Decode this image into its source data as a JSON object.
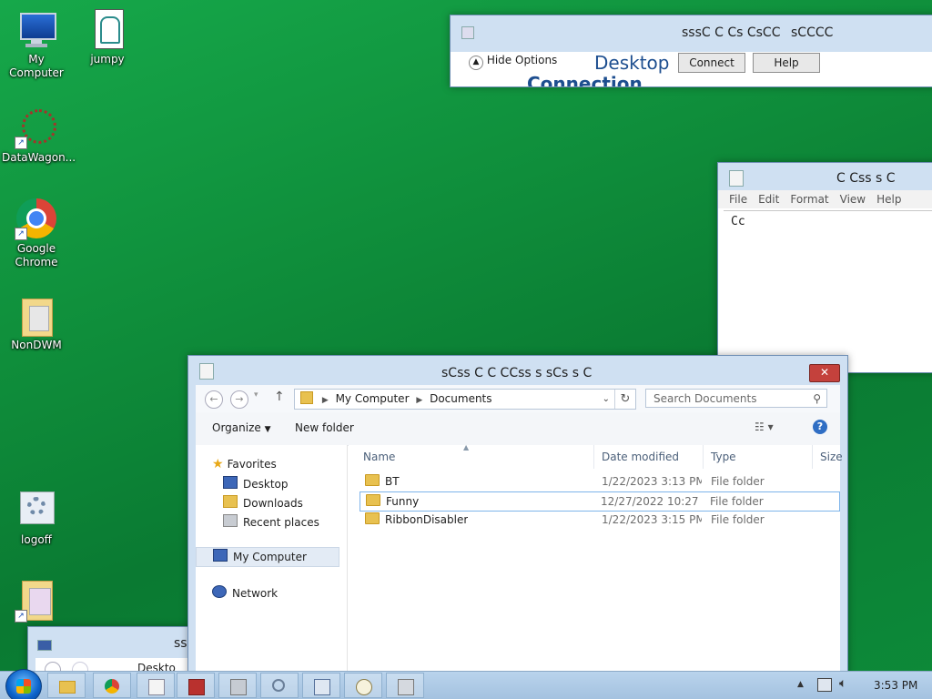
{
  "desktop": {
    "icons": [
      {
        "label": "My Computer"
      },
      {
        "label": "jumpy"
      },
      {
        "label": "DataWagon..."
      },
      {
        "label": "Google Chrome"
      },
      {
        "label": "NonDWM"
      },
      {
        "label": "logoff"
      }
    ]
  },
  "rdp": {
    "title": "sssC C Cs CsCC",
    "title_right": "sCCCC",
    "hide_options": "Hide Options",
    "brand": "Desktop",
    "brand2": "Connection",
    "connect": "Connect",
    "help": "Help"
  },
  "notepad": {
    "title": "C Css  s  C",
    "menu": [
      "File",
      "Edit",
      "Format",
      "View",
      "Help"
    ],
    "content": "Cc"
  },
  "explorer": {
    "title": "sCss C C CCss s sCs s  C",
    "close": "✕",
    "address": [
      "My Computer",
      "Documents"
    ],
    "search_placeholder": "Search Documents",
    "organize": "Organize",
    "new_folder": "New folder",
    "nav": {
      "favorites": "Favorites",
      "desktop": "Desktop",
      "downloads": "Downloads",
      "recent": "Recent places",
      "computer": "My Computer",
      "network": "Network"
    },
    "columns": [
      "Name",
      "Date modified",
      "Type",
      "Size"
    ],
    "rows": [
      {
        "name": "BT",
        "date": "1/22/2023 3:13 PM",
        "type": "File folder"
      },
      {
        "name": "Funny",
        "date": "12/27/2022 10:27 ...",
        "type": "File folder"
      },
      {
        "name": "RibbonDisabler",
        "date": "1/22/2023 3:15 PM",
        "type": "File folder"
      }
    ]
  },
  "small_window": {
    "title": "sss",
    "addr": "Deskto"
  },
  "taskbar": {
    "clock": "3:53 PM"
  }
}
